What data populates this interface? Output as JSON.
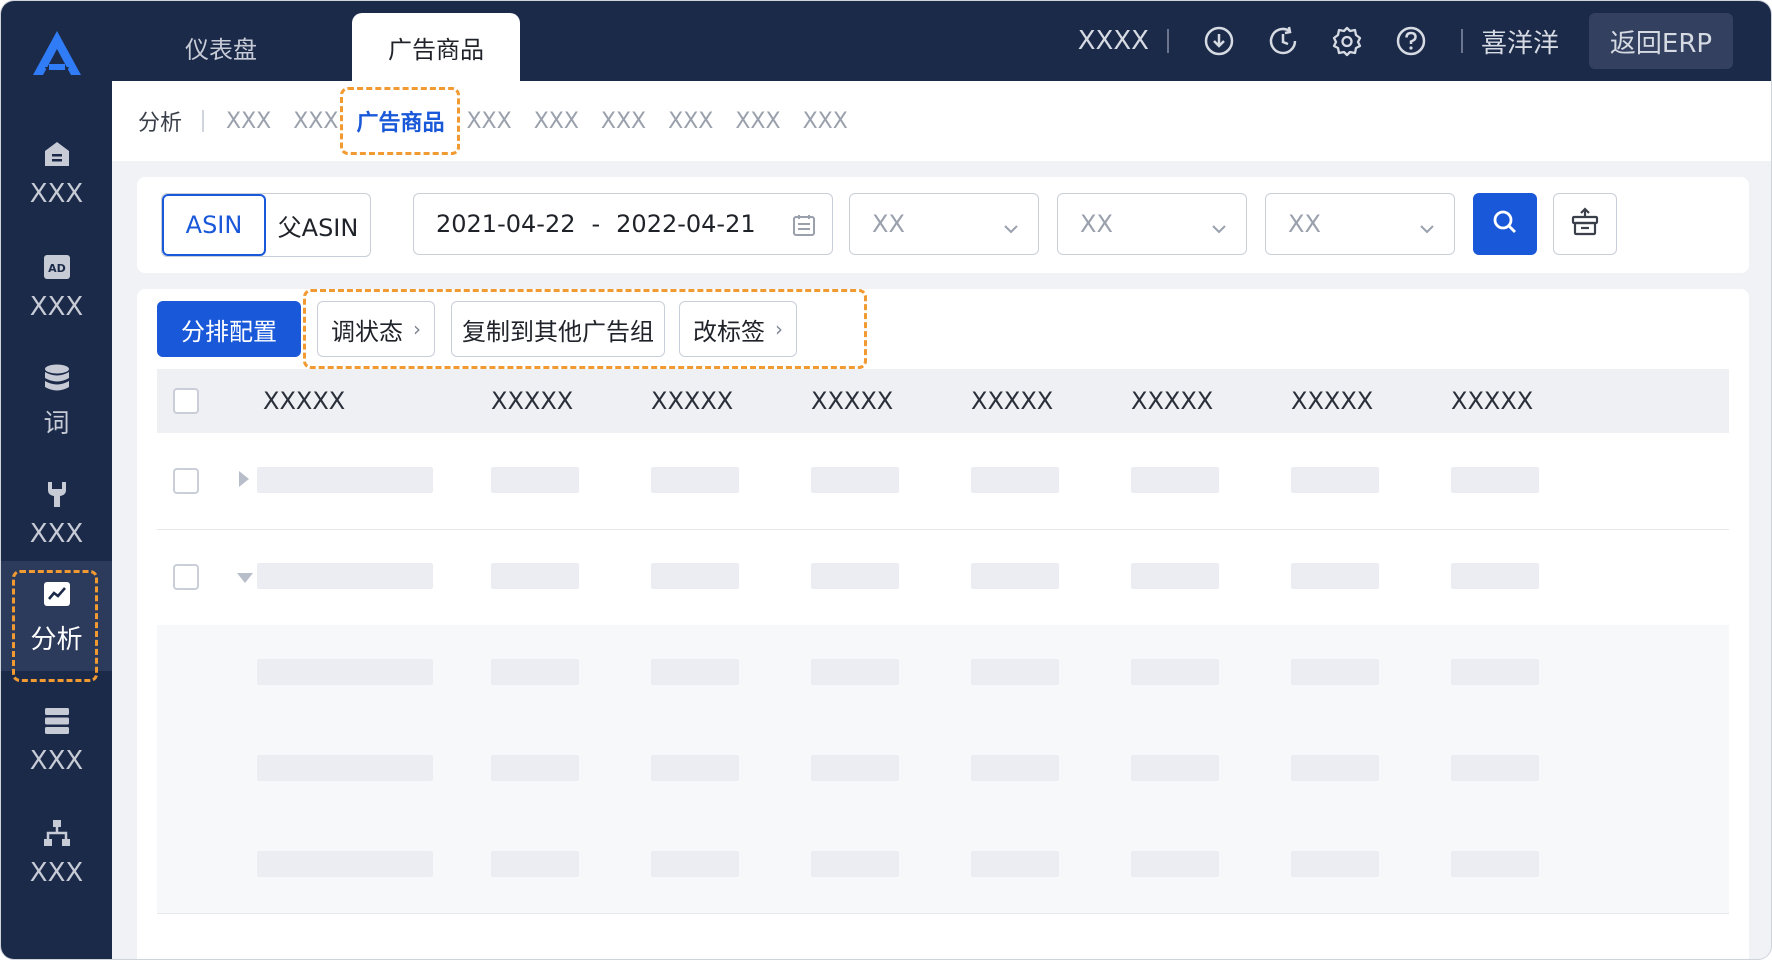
{
  "sidebar": {
    "items": [
      {
        "label": "XXX",
        "icon": "home-icon"
      },
      {
        "label": "XXX",
        "icon": "ad-icon"
      },
      {
        "label": "词",
        "icon": "database-icon"
      },
      {
        "label": "XXX",
        "icon": "wrench-icon"
      },
      {
        "label": "分析",
        "icon": "chart-icon",
        "active": true
      },
      {
        "label": "XXX",
        "icon": "server-icon"
      },
      {
        "label": "XXX",
        "icon": "sitemap-icon"
      }
    ]
  },
  "topbar": {
    "tabs": [
      {
        "label": "仪表盘"
      },
      {
        "label": "广告商品"
      }
    ],
    "store": "XXXX",
    "user": "喜洋洋",
    "erp_button": "返回ERP"
  },
  "subnav": {
    "section": "分析",
    "items": [
      {
        "label": "XXX"
      },
      {
        "label": "XXX"
      },
      {
        "label": "广告商品"
      },
      {
        "label": "XXX"
      },
      {
        "label": "XXX"
      },
      {
        "label": "XXX"
      },
      {
        "label": "XXX"
      },
      {
        "label": "XXX"
      },
      {
        "label": "XXX"
      }
    ]
  },
  "filters": {
    "segments": [
      {
        "label": "ASIN"
      },
      {
        "label": "父ASIN"
      }
    ],
    "date_start": "2021-04-22",
    "date_sep": "-",
    "date_end": "2022-04-21",
    "selects": [
      {
        "placeholder": "XX"
      },
      {
        "placeholder": "XX"
      },
      {
        "placeholder": "XX"
      }
    ]
  },
  "actions": {
    "primary": "分排配置",
    "adjust_status": "调状态",
    "copy_to_group": "复制到其他广告组",
    "change_tag": "改标签"
  },
  "table": {
    "headers": [
      "XXXXX",
      "XXXXX",
      "XXXXX",
      "XXXXX",
      "XXXXX",
      "XXXXX",
      "XXXXX",
      "XXXXX"
    ]
  },
  "colors": {
    "sidebar_bg": "#1c2a4a",
    "accent": "#1958d9",
    "highlight_dash": "#f29a32"
  }
}
